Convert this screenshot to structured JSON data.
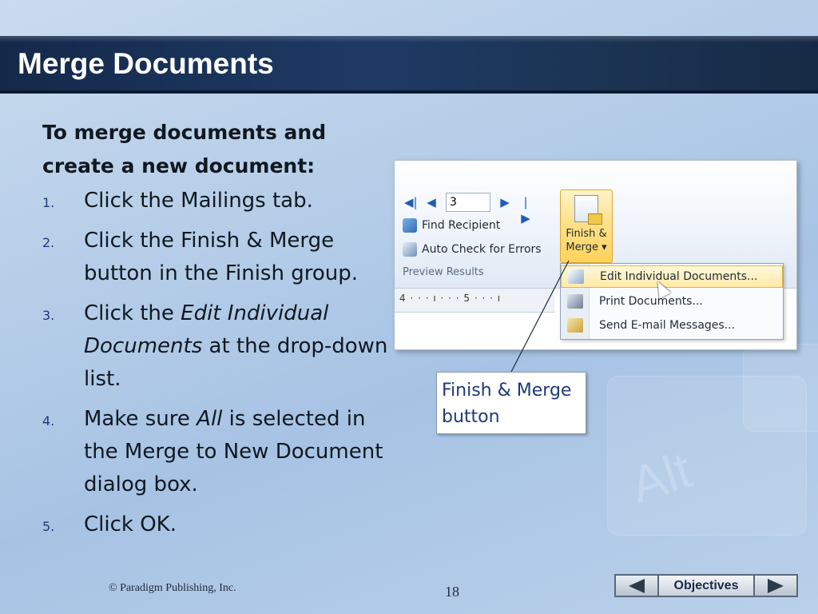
{
  "slide": {
    "title": "Merge Documents",
    "intro": "To merge documents and create a new document:",
    "steps": [
      {
        "num": "1.",
        "a": "Click the Mailings tab."
      },
      {
        "num": "2.",
        "a": "Click the Finish & Merge button in the Finish group."
      },
      {
        "num": "3.",
        "a": "Click the ",
        "b": "Edit Individual Documents",
        "c": " at the drop-down list."
      },
      {
        "num": "4.",
        "a": "Make sure ",
        "b": "All",
        "c": " is selected in the Merge to New Document dialog box."
      },
      {
        "num": "5.",
        "a": "Click OK."
      }
    ],
    "callout": "Finish & Merge button",
    "copyright": "© Paradigm Publishing, Inc.",
    "page_number": "18"
  },
  "screenshot": {
    "record_value": "3",
    "find_recipient": "Find Recipient",
    "auto_check": "Auto Check for Errors",
    "group_label": "Preview Results",
    "ruler_text": "4 · · · ı · · · 5 · · · ı",
    "finish_merge_line1": "Finish &",
    "finish_merge_line2": "Merge ▾",
    "menu": [
      "Edit Individual Documents...",
      "Print Documents...",
      "Send E-mail Messages..."
    ]
  },
  "nav": {
    "objectives_label": "Objectives",
    "prev_icon": "triangle-left-icon",
    "next_icon": "triangle-right-icon"
  },
  "colors": {
    "title_bar": "#1e3a64",
    "accent_blue": "#1f3a78",
    "menu_highlight": "#ffe9a6"
  }
}
